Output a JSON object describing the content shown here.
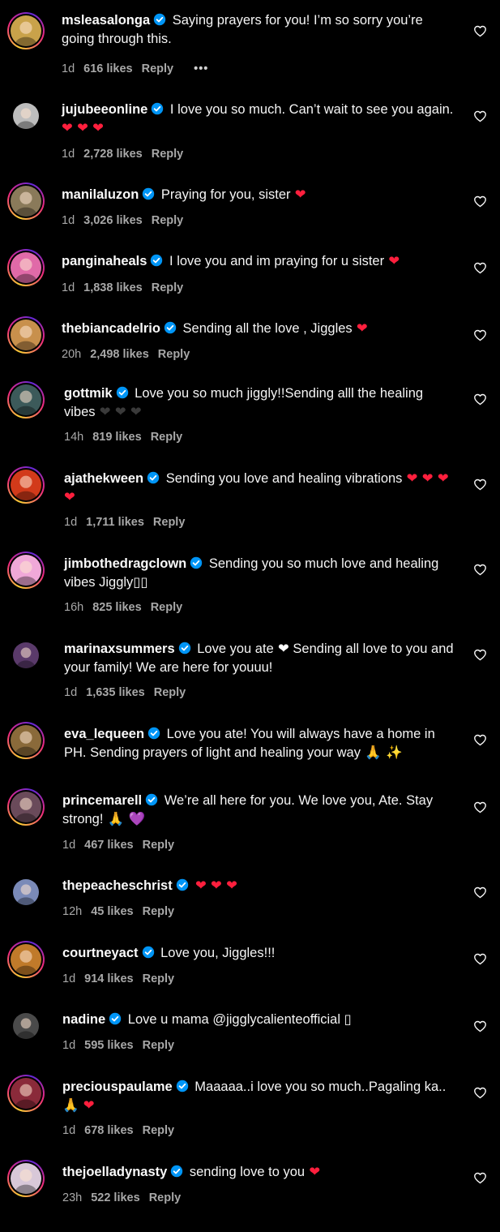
{
  "colors": {
    "background": "#000000",
    "verified": "#0095f6",
    "heart_emoji": "#ff1f3d",
    "meta_text": "#a8a8a8"
  },
  "icons": {
    "verified": "verified-badge-icon",
    "like": "heart-outline-icon",
    "more": "more-options-icon"
  },
  "comments": [
    {
      "username": "msleasalonga",
      "text": "Saying prayers for you! I’m so sorry you’re going through this.",
      "emoji": "",
      "emoji_color": "",
      "time": "1d",
      "likes": "616 likes",
      "reply": "Reply",
      "more": "•••",
      "ring": true,
      "avatar_bg": "#c9a24a"
    },
    {
      "username": "jujubeeonline",
      "text": "I love you so much. Can’t wait to see you again.",
      "emoji": "❤ ❤ ❤",
      "emoji_color": "red",
      "time": "1d",
      "likes": "2,728 likes",
      "reply": "Reply",
      "more": "",
      "ring": false,
      "avatar_bg": "#bdbdbd"
    },
    {
      "username": "manilaluzon",
      "text": "Praying for you, sister",
      "emoji": "❤",
      "emoji_color": "red",
      "time": "1d",
      "likes": "3,026 likes",
      "reply": "Reply",
      "more": "",
      "ring": true,
      "avatar_bg": "#8a7a5a"
    },
    {
      "username": "panginaheals",
      "text": "I love you and im praying for u sister",
      "emoji": "❤",
      "emoji_color": "red",
      "time": "1d",
      "likes": "1,838 likes",
      "reply": "Reply",
      "more": "",
      "ring": true,
      "avatar_bg": "#e06aa8"
    },
    {
      "username": "thebiancadelrio",
      "text": "Sending all the love , Jiggles",
      "emoji": "❤",
      "emoji_color": "red",
      "time": "20h",
      "likes": "2,498 likes",
      "reply": "Reply",
      "more": "",
      "ring": true,
      "avatar_bg": "#c8904c"
    },
    {
      "username": "gottmik",
      "text": "Love you so much jiggly!!Sending alll the healing vibes",
      "emoji": "❤ ❤ ❤",
      "emoji_color": "dark",
      "time": "14h",
      "likes": "819 likes",
      "reply": "Reply",
      "more": "",
      "ring": true,
      "avatar_bg": "#3c5a5a"
    },
    {
      "username": "ajathekween",
      "text": "Sending you love and healing vibrations",
      "emoji": "❤ ❤ ❤ ❤",
      "emoji_color": "red",
      "time": "1d",
      "likes": "1,711 likes",
      "reply": "Reply",
      "more": "",
      "ring": true,
      "avatar_bg": "#d23a1a"
    },
    {
      "username": "jimbothedragclown",
      "text": "Sending you so much love and healing vibes Jiggly▯▯",
      "emoji": "",
      "emoji_color": "",
      "time": "16h",
      "likes": "825 likes",
      "reply": "Reply",
      "more": "",
      "ring": true,
      "avatar_bg": "#f0a8d8"
    },
    {
      "username": "marinaxsummers",
      "text": "Love you ate",
      "emoji": "❤",
      "emoji_color": "white",
      "text2": "Sending all love to you and your family! We are here for youuu!",
      "time": "1d",
      "likes": "1,635 likes",
      "reply": "Reply",
      "more": "",
      "ring": false,
      "avatar_bg": "#5a3a6a"
    },
    {
      "username": "eva_lequeen",
      "text": "Love you ate! You will always have a home in PH. Sending prayers of light and healing your way",
      "emoji": "🙏 ✨",
      "emoji_color": "gold",
      "time": "",
      "likes": "",
      "reply": "",
      "more": "",
      "ring": true,
      "avatar_bg": "#8a6a3a"
    },
    {
      "username": "princemarell",
      "text": "We’re all here for you. We love you, Ate. Stay strong!",
      "emoji": "🙏 💜",
      "emoji_color": "purple",
      "time": "1d",
      "likes": "467 likes",
      "reply": "Reply",
      "more": "",
      "ring": true,
      "avatar_bg": "#6a4a5a"
    },
    {
      "username": "thepeacheschrist",
      "text": "",
      "emoji": "❤ ❤ ❤",
      "emoji_color": "red",
      "time": "12h",
      "likes": "45 likes",
      "reply": "Reply",
      "more": "",
      "ring": false,
      "avatar_bg": "#7a8ab8"
    },
    {
      "username": "courtneyact",
      "text": "Love you, Jiggles!!!",
      "emoji": "",
      "emoji_color": "",
      "time": "1d",
      "likes": "914 likes",
      "reply": "Reply",
      "more": "",
      "ring": true,
      "avatar_bg": "#c07a2a"
    },
    {
      "username": "nadine",
      "text": "Love u mama @jigglycalienteofficial ▯",
      "emoji": "",
      "emoji_color": "",
      "time": "1d",
      "likes": "595 likes",
      "reply": "Reply",
      "more": "",
      "ring": false,
      "avatar_bg": "#4a4a4a"
    },
    {
      "username": "preciouspaulame",
      "text": "Maaaaa..i love you so much..Pagaling ka..",
      "emoji": "🙏 ❤",
      "emoji_color": "red",
      "time": "1d",
      "likes": "678 likes",
      "reply": "Reply",
      "more": "",
      "ring": true,
      "avatar_bg": "#8a2a3a"
    },
    {
      "username": "thejoelladynasty",
      "text": "sending love to you",
      "emoji": "❤",
      "emoji_color": "red",
      "time": "23h",
      "likes": "522 likes",
      "reply": "Reply",
      "more": "",
      "ring": true,
      "avatar_bg": "#d8c8d8"
    }
  ]
}
